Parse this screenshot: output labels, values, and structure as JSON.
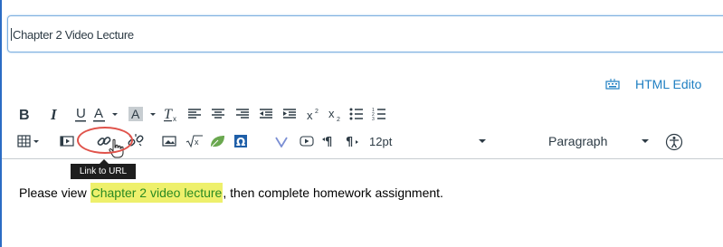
{
  "title_field": {
    "value": "Chapter  2 Video Lecture"
  },
  "header": {
    "html_editor_label": "HTML Edito"
  },
  "toolbar": {
    "format_row": [
      "bold-button",
      "italic-button",
      "underline-button",
      "font-color-button",
      "background-color-button",
      "clear-formatting-button",
      "align-left-button",
      "align-center-button",
      "align-right-button",
      "indent-button",
      "outdent-button",
      "superscript-button",
      "subscript-button",
      "bullet-list-button",
      "numbered-list-button"
    ],
    "insert_row": {
      "font_size_value": "12pt",
      "paragraph_value": "Paragraph"
    },
    "tooltip": "Link to URL"
  },
  "content": {
    "prefix": "Please view ",
    "link_text": "Chapter 2 video lecture",
    "suffix": ", then complete homework assignment."
  },
  "colors": {
    "accent_blue": "#1f7fc2",
    "link_green": "#2a8a22",
    "highlight_yellow": "#eef06c",
    "annotation_red": "#e0534b"
  }
}
